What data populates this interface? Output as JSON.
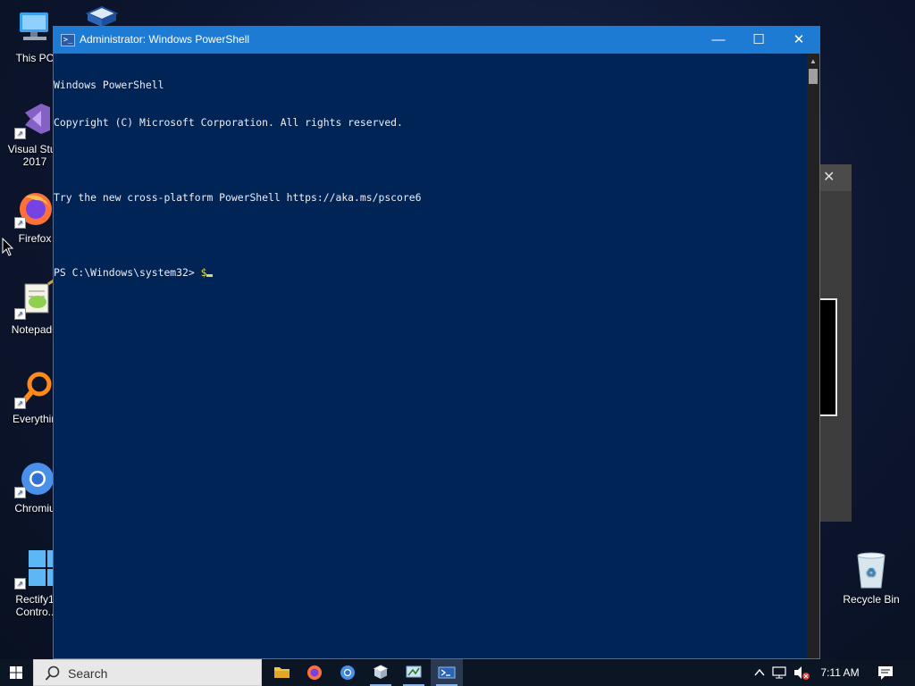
{
  "desktop": {
    "icons": [
      {
        "label": "This PC"
      },
      {
        "label": "Visual Stud\n2017"
      },
      {
        "label": "Firefox"
      },
      {
        "label": "Notepad+"
      },
      {
        "label": "Everythin"
      },
      {
        "label": "Chromiu"
      },
      {
        "label": "Rectify1\nContro.."
      },
      {
        "label": "Recycle Bin"
      }
    ]
  },
  "window": {
    "title": "Administrator: Windows PowerShell",
    "console_lines": [
      "Windows PowerShell",
      "Copyright (C) Microsoft Corporation. All rights reserved.",
      "",
      "Try the new cross-platform PowerShell https://aka.ms/pscore6",
      ""
    ],
    "prompt": "PS C:\\Windows\\system32> ",
    "typed": "$"
  },
  "taskbar": {
    "search_placeholder": "Search",
    "apps": [
      "file-explorer",
      "firefox",
      "chromium",
      "virtualbox",
      "rectify",
      "powershell"
    ],
    "clock": "7:11 AM"
  },
  "colors": {
    "console_bg": "#012456",
    "titlebar": "#1d7bd3",
    "console_text": "#eeedf0",
    "prompt_accent": "#e6d55a"
  }
}
